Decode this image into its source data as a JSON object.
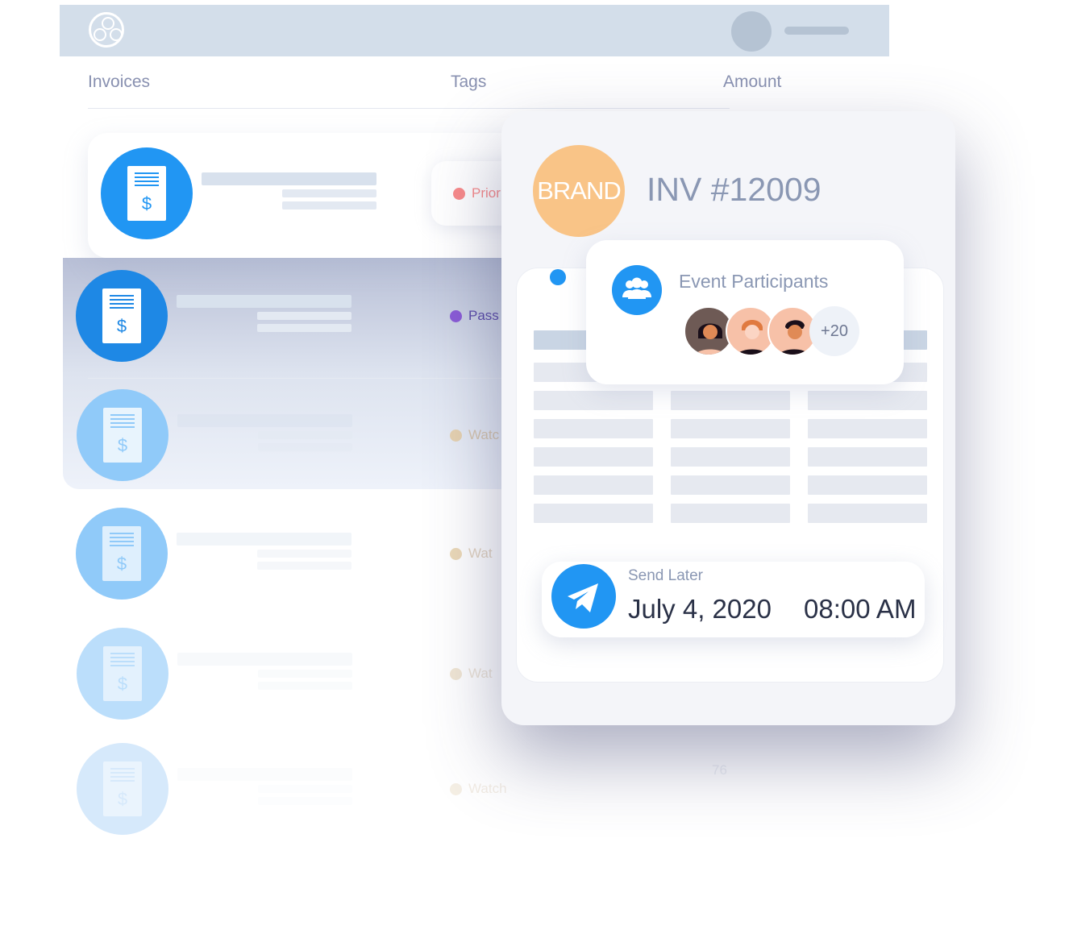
{
  "header": {
    "logo": "film-reel-logo",
    "avatar": "user-avatar"
  },
  "columns": {
    "invoices": "Invoices",
    "tags": "Tags",
    "amount": "Amount"
  },
  "rows": [
    {
      "tag": "Prior",
      "tag_color": "#f98a8a",
      "text_color": "#f98a8a"
    },
    {
      "tag": "Pass",
      "tag_color": "#8a5bd6",
      "text_color": "#5a4aa8"
    },
    {
      "tag": "Watc",
      "tag_color": "#e6d2b0",
      "text_color": "#d7c6ad"
    },
    {
      "tag": "Wat",
      "tag_color": "#ecd9b8",
      "text_color": "#e2d3bf"
    },
    {
      "tag": "Wat",
      "tag_color": "#f1e6d4",
      "text_color": "#ece3d6"
    },
    {
      "tag": "Watch",
      "tag_color": "#f5efe4",
      "text_color": "#f2ece4",
      "amount": "76"
    }
  ],
  "invoice": {
    "brand": "BRAND",
    "number": "INV #12009",
    "brand_color": "#f9c487"
  },
  "participants": {
    "title": "Event Participants",
    "more": "+20",
    "icon": "group-icon"
  },
  "send_later": {
    "label": "Send Later",
    "date": "July 4, 2020",
    "time": "08:00 AM",
    "icon": "paper-plane-icon"
  },
  "colors": {
    "accent": "#2196f3",
    "header": "#d3deea"
  }
}
